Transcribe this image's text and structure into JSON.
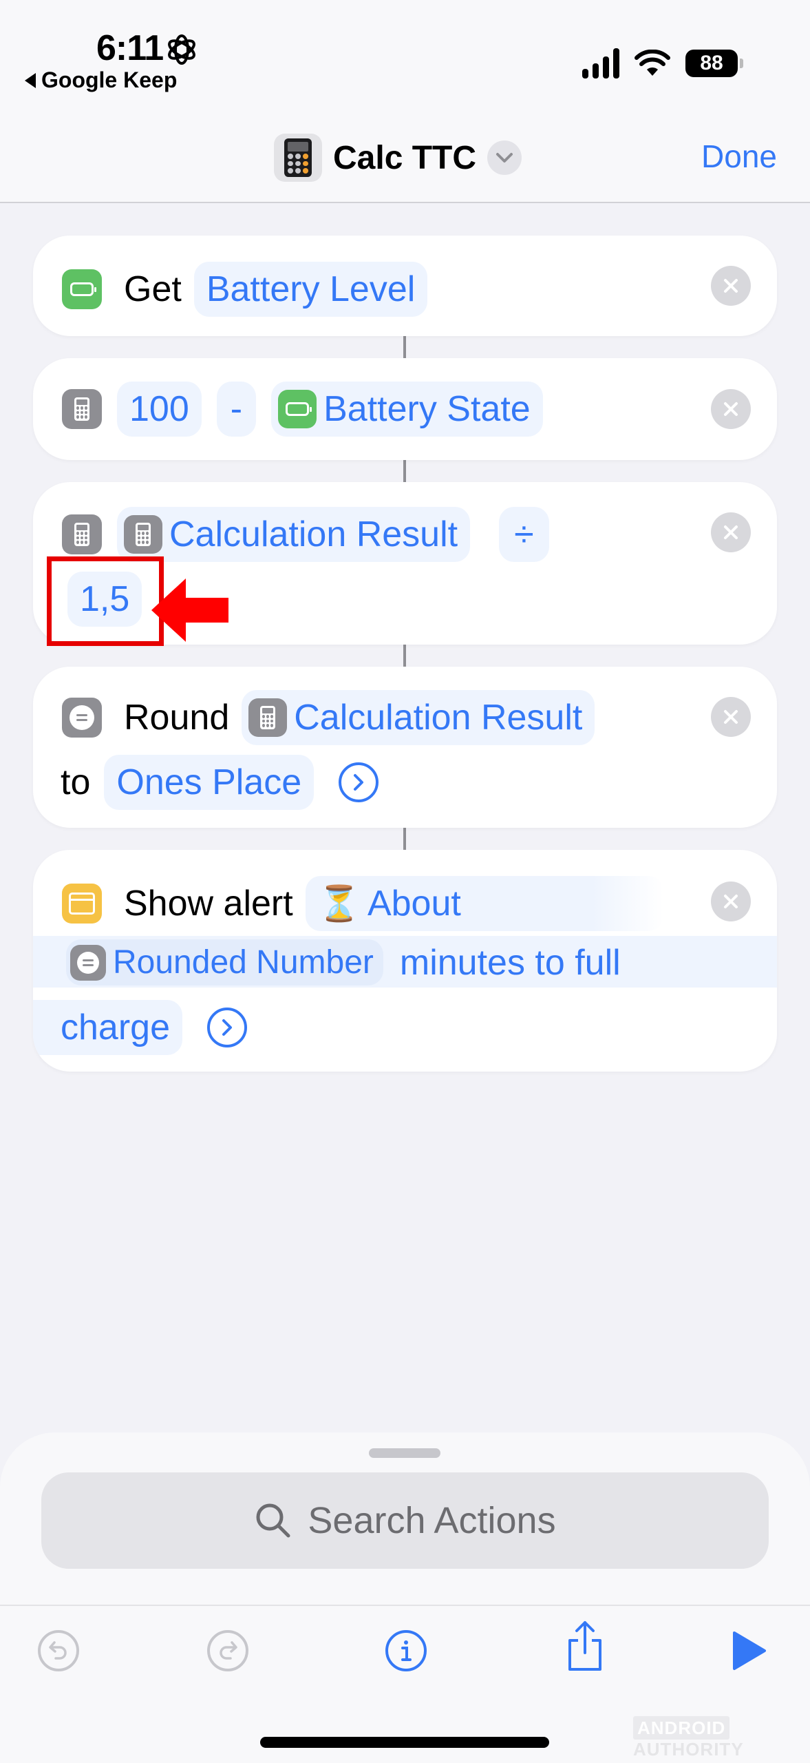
{
  "status_bar": {
    "time": "6:11",
    "back_app": "Google Keep",
    "battery_level": "88"
  },
  "nav": {
    "title": "Calc TTC",
    "done_label": "Done"
  },
  "actions": [
    {
      "id": "get-battery",
      "verb": "Get",
      "param": "Battery Level"
    },
    {
      "id": "calculate-subtract",
      "operand1": "100",
      "operator": "-",
      "operand2": "Battery State"
    },
    {
      "id": "calculate-divide",
      "operand1": "Calculation Result",
      "operator": "÷",
      "operand2": "1,5"
    },
    {
      "id": "round",
      "verb": "Round",
      "param": "Calculation Result",
      "connector": "to",
      "option": "Ones Place"
    },
    {
      "id": "show-alert",
      "verb": "Show alert",
      "emoji": "⏳",
      "text_start": "About",
      "variable": "Rounded Number",
      "text_mid": "minutes to full",
      "text_end": "charge"
    }
  ],
  "sheet": {
    "search_placeholder": "Search Actions"
  },
  "toolbar": {
    "undo": "undo",
    "redo": "redo",
    "info": "info",
    "share": "share",
    "run": "run"
  },
  "watermark": {
    "part1": "ANDROID",
    "part2": "AUTHORITY"
  },
  "colors": {
    "accent": "#3478f6",
    "highlight": "#e60000",
    "battery_icon": "#5ec163",
    "calc_icon": "#8e8e93",
    "alert_icon": "#f6c244"
  }
}
